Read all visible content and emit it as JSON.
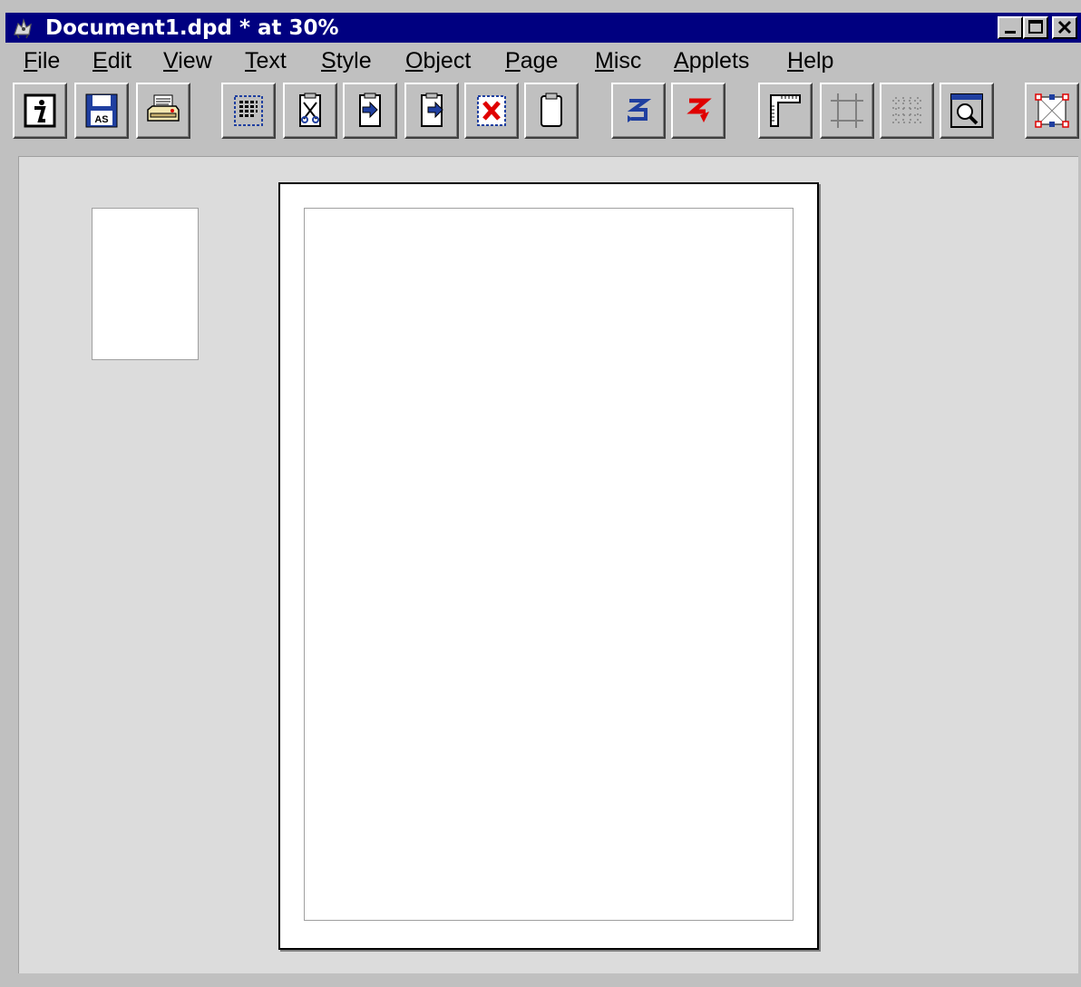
{
  "window": {
    "title": "Document1.dpd * at 30%",
    "title_bar_color": "#000080",
    "icons": {
      "app": "goat-app-icon",
      "minimize": "minimize-icon",
      "maximize": "maximize-icon",
      "close": "close-icon"
    }
  },
  "menu": {
    "items": [
      {
        "label": "File",
        "accel": "F",
        "rest": "ile"
      },
      {
        "label": "Edit",
        "accel": "E",
        "rest": "dit"
      },
      {
        "label": "View",
        "accel": "V",
        "rest": "iew"
      },
      {
        "label": "Text",
        "accel": "T",
        "rest": "ext"
      },
      {
        "label": "Style",
        "accel": "S",
        "rest": "tyle"
      },
      {
        "label": "Object",
        "accel": "O",
        "rest": "bject"
      },
      {
        "label": "Page",
        "accel": "P",
        "rest": "age"
      },
      {
        "label": "Misc",
        "accel": "M",
        "rest": "isc"
      },
      {
        "label": "Applets",
        "accel": "A",
        "rest": "pplets"
      },
      {
        "label": "Help",
        "accel": "H",
        "rest": "elp"
      }
    ]
  },
  "toolbar": {
    "buttons": [
      "info-icon",
      "save-as-icon",
      "print-icon",
      "select-all-icon",
      "cut-icon",
      "copy-icon",
      "paste-icon",
      "delete-icon",
      "clipboard-icon",
      "undo-icon",
      "redo-icon",
      "rulers-icon",
      "guides-icon",
      "grid-icon",
      "zoom-icon",
      "frame-icon"
    ],
    "accent_blue": "#1f3fa0",
    "accent_red": "#e00000"
  },
  "document": {
    "zoom": "30%",
    "page_background": "#ffffff",
    "workspace_background": "#dcdcdc"
  }
}
